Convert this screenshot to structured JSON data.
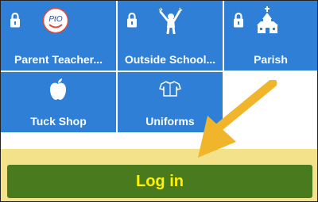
{
  "tiles": [
    {
      "label": "Parent Teacher...",
      "locked": true,
      "icon": "pto-smiley-icon"
    },
    {
      "label": "Outside School...",
      "locked": true,
      "icon": "waving-child-icon"
    },
    {
      "label": "Parish",
      "locked": true,
      "icon": "church-icon"
    },
    {
      "label": "Tuck Shop",
      "locked": false,
      "icon": "apple-icon"
    },
    {
      "label": "Uniforms",
      "locked": false,
      "icon": "shirt-icon"
    }
  ],
  "pto_logo_text": "PtO",
  "login": {
    "label": "Log in"
  },
  "colors": {
    "tile_blue": "#2f7fd6",
    "band_yellow": "#f3e28a",
    "login_green": "#4a7a1e",
    "login_text": "#fff200",
    "arrow": "#f0b52a"
  }
}
